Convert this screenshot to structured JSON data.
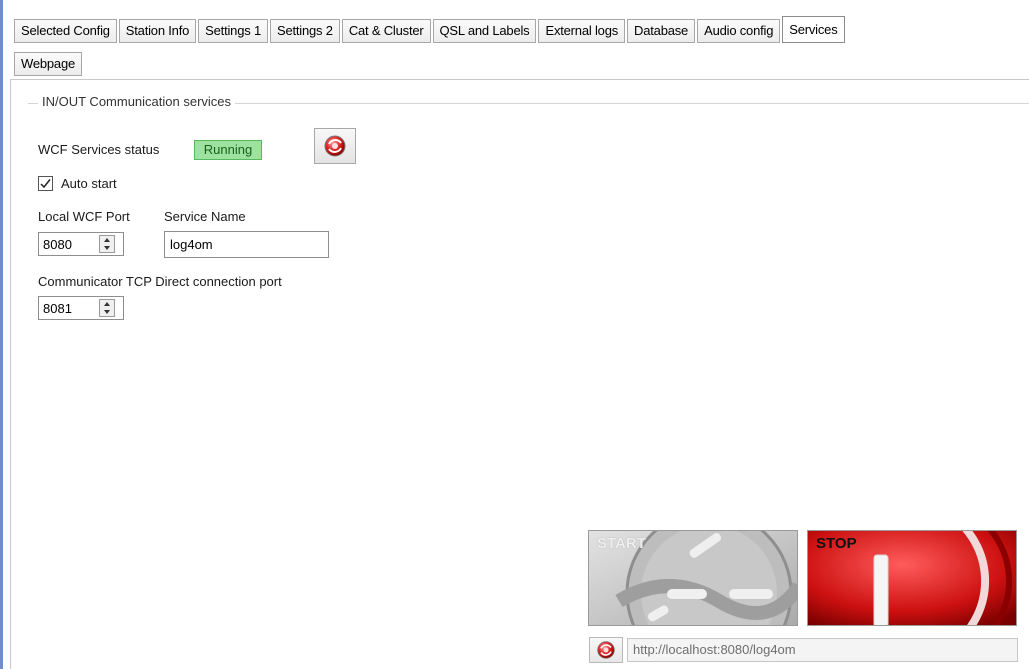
{
  "tabs_row1": [
    {
      "label": "Selected Config",
      "active": false
    },
    {
      "label": "Station Info",
      "active": false
    },
    {
      "label": "Settings 1",
      "active": false
    },
    {
      "label": "Settings 2",
      "active": false
    },
    {
      "label": "Cat & Cluster",
      "active": false
    },
    {
      "label": "QSL and Labels",
      "active": false
    },
    {
      "label": "External logs",
      "active": false
    },
    {
      "label": "Database",
      "active": false
    },
    {
      "label": "Audio config",
      "active": false
    },
    {
      "label": "Services",
      "active": true
    }
  ],
  "tabs_row2": [
    {
      "label": "Webpage",
      "active": false
    }
  ],
  "group": {
    "title": "IN/OUT Communication services"
  },
  "wcf": {
    "status_label": "WCF Services status",
    "status_value": "Running",
    "status_color": "#9de39f",
    "restart_icon": "refresh-record-icon"
  },
  "auto_start": {
    "label": "Auto start",
    "checked": true
  },
  "local_port": {
    "label": "Local WCF Port",
    "value": "8080"
  },
  "service_name": {
    "label": "Service Name",
    "value": "log4om"
  },
  "tcp_port": {
    "label": "Communicator TCP Direct connection port",
    "value": "8081"
  },
  "start_button": {
    "label": "START",
    "enabled": false
  },
  "stop_button": {
    "label": "STOP",
    "enabled": true,
    "color": "#c41010"
  },
  "url": {
    "value": "http://localhost:8080/log4om"
  }
}
